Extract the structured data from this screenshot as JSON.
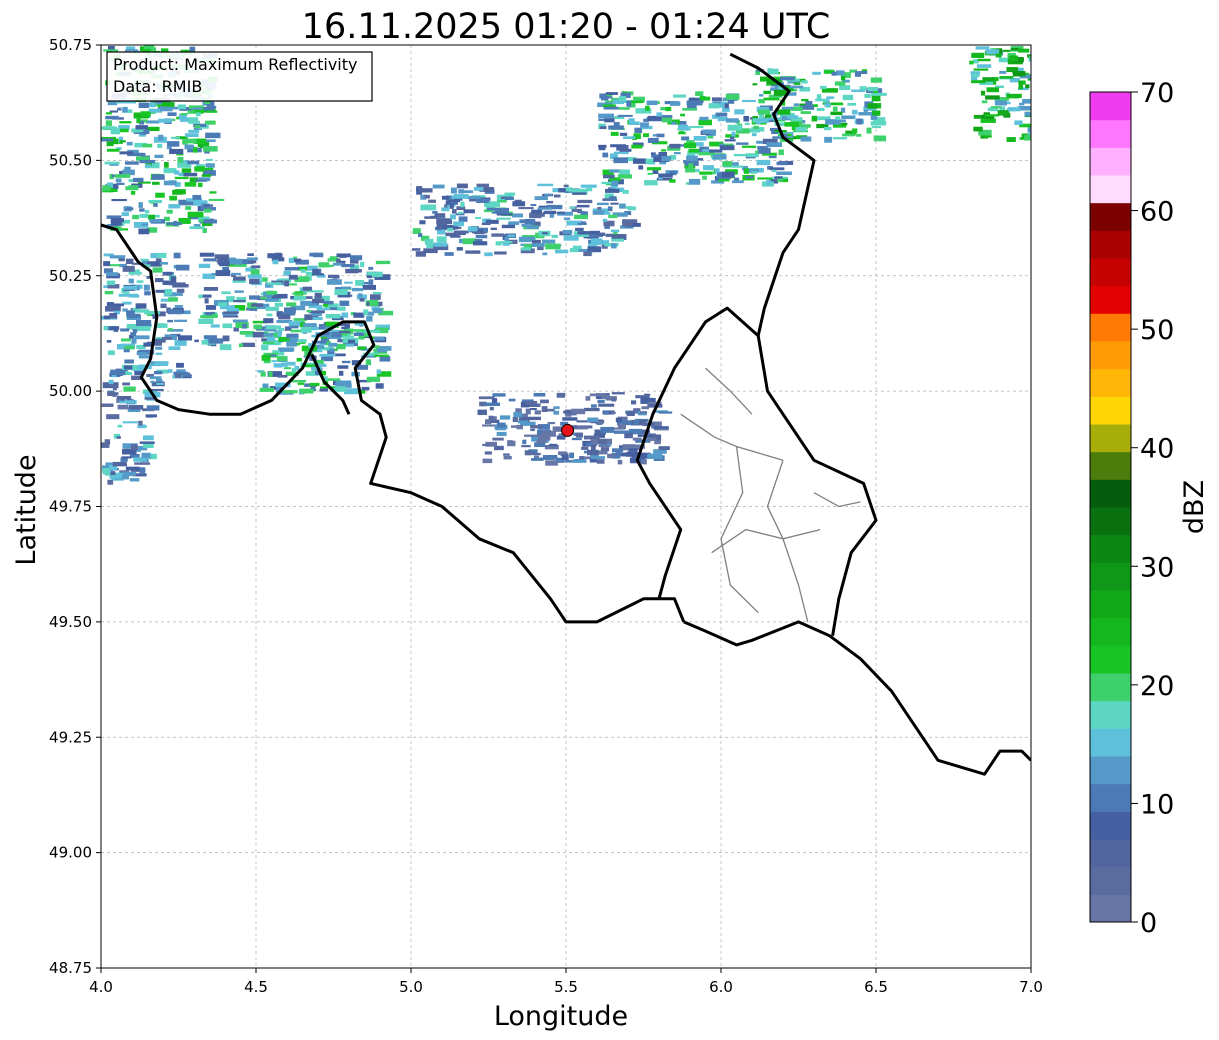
{
  "figure": {
    "title": "16.11.2025 01:20 - 01:24 UTC",
    "xlabel": "Longitude",
    "ylabel": "Latitude",
    "info_lines": [
      "Product: Maximum Reflectivity",
      "Data: RMIB"
    ]
  },
  "axes": {
    "xlim": [
      4.0,
      7.0
    ],
    "ylim": [
      48.75,
      50.75
    ],
    "x_ticks": [
      "4.0",
      "4.5",
      "5.0",
      "5.5",
      "6.0",
      "6.5",
      "7.0"
    ],
    "y_ticks": [
      "48.75",
      "49.00",
      "49.25",
      "49.50",
      "49.75",
      "50.00",
      "50.25",
      "50.50",
      "50.75"
    ],
    "grid": true
  },
  "radar_site": {
    "lon": 5.505,
    "lat": 49.915,
    "color": "#e8131a"
  },
  "colorbar": {
    "label": "dBZ",
    "min": 0,
    "max": 70,
    "step": 2.5,
    "ticks": [
      "0",
      "10",
      "20",
      "30",
      "40",
      "50",
      "60",
      "70"
    ],
    "colors": [
      "#6676a6",
      "#5a6ba0",
      "#51659f",
      "#4460a0",
      "#4c7ab4",
      "#5599c8",
      "#5fc0db",
      "#5dd6c3",
      "#3ed16b",
      "#18c524",
      "#14b81e",
      "#12a81a",
      "#0f9817",
      "#0c8714",
      "#0a7111",
      "#055c0c",
      "#4b7c0c",
      "#a8ae09",
      "#ffd505",
      "#ffb606",
      "#ff9b06",
      "#ff7b06",
      "#e40101",
      "#c60101",
      "#a90101",
      "#7c0101",
      "#ffdcff",
      "#ffb0ff",
      "#ff76ff",
      "#f03cf0"
    ]
  },
  "chart_data": {
    "type": "heatmap",
    "title": "16.11.2025 01:20 - 01:24 UTC",
    "xlabel": "Longitude",
    "ylabel": "Latitude",
    "xlim": [
      4.0,
      7.0
    ],
    "ylim": [
      48.75,
      50.75
    ],
    "colorbar_label": "dBZ",
    "colorbar_range": [
      0,
      70
    ],
    "echo_regions": [
      {
        "lon": [
          4.0,
          4.35
        ],
        "lat": [
          50.35,
          50.75
        ],
        "dbz": 18
      },
      {
        "lon": [
          4.0,
          4.25
        ],
        "lat": [
          50.0,
          50.3
        ],
        "dbz": 12
      },
      {
        "lon": [
          4.0,
          4.15
        ],
        "lat": [
          49.8,
          50.0
        ],
        "dbz": 10
      },
      {
        "lon": [
          4.3,
          4.9
        ],
        "lat": [
          50.1,
          50.3
        ],
        "dbz": 14
      },
      {
        "lon": [
          4.5,
          4.9
        ],
        "lat": [
          50.0,
          50.15
        ],
        "dbz": 16
      },
      {
        "lon": [
          5.0,
          5.7
        ],
        "lat": [
          50.3,
          50.45
        ],
        "dbz": 12
      },
      {
        "lon": [
          5.6,
          6.2
        ],
        "lat": [
          50.45,
          50.65
        ],
        "dbz": 16
      },
      {
        "lon": [
          6.1,
          6.5
        ],
        "lat": [
          50.55,
          50.7
        ],
        "dbz": 20
      },
      {
        "lon": [
          6.8,
          7.0
        ],
        "lat": [
          50.55,
          50.75
        ],
        "dbz": 22
      },
      {
        "lon": [
          5.2,
          5.8
        ],
        "lat": [
          49.85,
          50.0
        ],
        "dbz": 6
      }
    ]
  },
  "geo": {
    "national_borders": [
      [
        [
          4.0,
          50.36
        ],
        [
          4.05,
          50.35
        ],
        [
          4.12,
          50.28
        ],
        [
          4.16,
          50.26
        ],
        [
          4.18,
          50.16
        ],
        [
          4.16,
          50.07
        ],
        [
          4.13,
          50.03
        ],
        [
          4.18,
          49.98
        ],
        [
          4.25,
          49.96
        ],
        [
          4.35,
          49.95
        ],
        [
          4.45,
          49.95
        ],
        [
          4.55,
          49.98
        ],
        [
          4.65,
          50.05
        ],
        [
          4.7,
          50.12
        ],
        [
          4.78,
          50.15
        ],
        [
          4.85,
          50.15
        ],
        [
          4.88,
          50.1
        ],
        [
          4.82,
          50.05
        ],
        [
          4.84,
          49.98
        ],
        [
          4.9,
          49.95
        ],
        [
          4.92,
          49.9
        ],
        [
          4.87,
          49.8
        ],
        [
          5.0,
          49.78
        ],
        [
          5.1,
          49.75
        ],
        [
          5.22,
          49.68
        ],
        [
          5.33,
          49.65
        ],
        [
          5.45,
          49.55
        ],
        [
          5.5,
          49.5
        ],
        [
          5.6,
          49.5
        ],
        [
          5.75,
          49.55
        ],
        [
          5.85,
          49.55
        ],
        [
          5.88,
          49.5
        ]
      ],
      [
        [
          4.68,
          50.08
        ],
        [
          4.72,
          50.02
        ],
        [
          4.78,
          49.98
        ],
        [
          4.8,
          49.95
        ]
      ],
      [
        [
          5.88,
          49.5
        ],
        [
          5.95,
          49.48
        ],
        [
          6.05,
          49.45
        ],
        [
          6.1,
          49.46
        ],
        [
          6.25,
          49.5
        ],
        [
          6.35,
          49.47
        ],
        [
          6.45,
          49.42
        ],
        [
          6.55,
          49.35
        ],
        [
          6.6,
          49.3
        ],
        [
          6.7,
          49.2
        ],
        [
          6.85,
          49.17
        ],
        [
          6.9,
          49.22
        ],
        [
          6.97,
          49.22
        ],
        [
          7.0,
          49.2
        ]
      ],
      [
        [
          5.8,
          49.55
        ],
        [
          5.82,
          49.6
        ],
        [
          5.87,
          49.7
        ],
        [
          5.77,
          49.8
        ],
        [
          5.73,
          49.85
        ],
        [
          5.78,
          49.95
        ],
        [
          5.85,
          50.05
        ],
        [
          5.95,
          50.15
        ],
        [
          6.02,
          50.18
        ],
        [
          6.12,
          50.12
        ],
        [
          6.15,
          50.0
        ],
        [
          6.2,
          49.95
        ],
        [
          6.3,
          49.85
        ],
        [
          6.46,
          49.8
        ],
        [
          6.5,
          49.72
        ],
        [
          6.42,
          49.65
        ],
        [
          6.38,
          49.55
        ],
        [
          6.36,
          49.47
        ]
      ],
      [
        [
          6.12,
          50.12
        ],
        [
          6.14,
          50.18
        ],
        [
          6.2,
          50.3
        ],
        [
          6.25,
          50.35
        ],
        [
          6.3,
          50.5
        ],
        [
          6.2,
          50.55
        ],
        [
          6.17,
          50.6
        ],
        [
          6.22,
          50.65
        ],
        [
          6.12,
          50.7
        ],
        [
          6.03,
          50.73
        ]
      ]
    ],
    "district_lines": [
      [
        [
          5.97,
          49.65
        ],
        [
          6.08,
          49.7
        ],
        [
          6.2,
          49.68
        ],
        [
          6.32,
          49.7
        ]
      ],
      [
        [
          5.87,
          49.95
        ],
        [
          5.98,
          49.9
        ],
        [
          6.05,
          49.88
        ],
        [
          6.2,
          49.85
        ]
      ],
      [
        [
          6.05,
          49.88
        ],
        [
          6.07,
          49.78
        ],
        [
          6.0,
          49.68
        ],
        [
          6.03,
          49.58
        ],
        [
          6.12,
          49.52
        ]
      ],
      [
        [
          6.2,
          49.85
        ],
        [
          6.15,
          49.75
        ],
        [
          6.2,
          49.68
        ],
        [
          6.25,
          49.58
        ],
        [
          6.28,
          49.5
        ]
      ],
      [
        [
          5.95,
          50.05
        ],
        [
          6.03,
          50.0
        ],
        [
          6.1,
          49.95
        ]
      ],
      [
        [
          6.3,
          49.78
        ],
        [
          6.38,
          49.75
        ],
        [
          6.45,
          49.76
        ]
      ]
    ]
  }
}
